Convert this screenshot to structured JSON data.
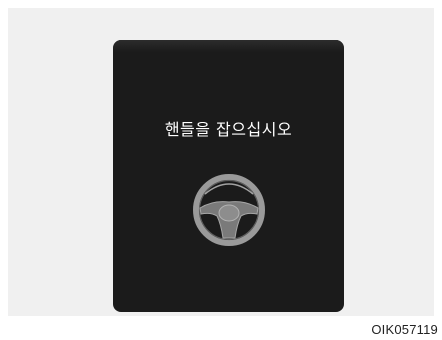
{
  "display": {
    "message": "핸들을 잡으십시오",
    "icon": "steering-wheel-icon"
  },
  "caption": "OIK057119",
  "colors": {
    "panel_background": "#1b1b1b",
    "frame_background": "#f0f0f0",
    "text": "#ffffff",
    "wheel_rim": "#9a9a9a",
    "wheel_hub": "#6f6f6f"
  }
}
